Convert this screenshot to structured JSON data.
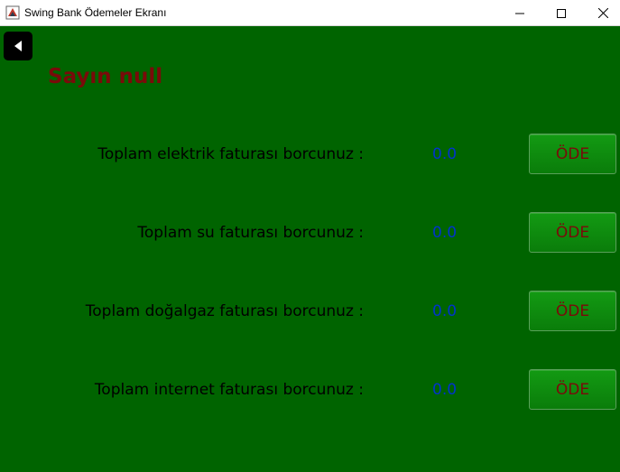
{
  "window": {
    "title": "Swing Bank Ödemeler Ekranı"
  },
  "greeting": "Sayın null",
  "bills": [
    {
      "label": "Toplam elektrik faturası borcunuz :",
      "amount": "0.0",
      "button": "ÖDE"
    },
    {
      "label": "Toplam su faturası borcunuz :",
      "amount": "0.0",
      "button": "ÖDE"
    },
    {
      "label": "Toplam doğalgaz faturası borcunuz :",
      "amount": "0.0",
      "button": "ÖDE"
    },
    {
      "label": "Toplam internet faturası borcunuz :",
      "amount": "0.0",
      "button": "ÖDE"
    }
  ],
  "icons": {
    "app": "java-app-icon",
    "back": "back-arrow-icon",
    "minimize": "minimize-icon",
    "maximize": "maximize-icon",
    "close": "close-icon"
  },
  "colors": {
    "background": "#006400",
    "greeting": "#7a0a0a",
    "amount": "#0033cc",
    "button_text": "#7a0a0a"
  }
}
